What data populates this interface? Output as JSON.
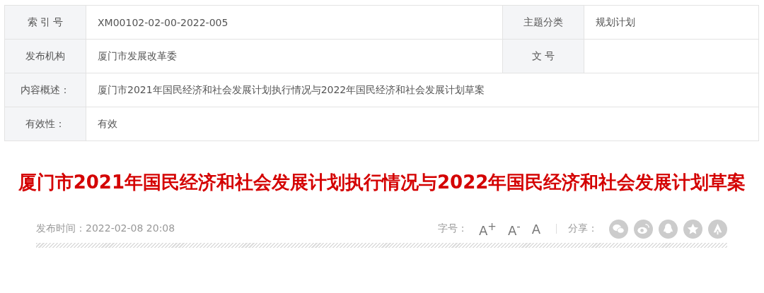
{
  "info_table": {
    "rows": [
      {
        "cells": [
          {
            "kind": "label",
            "text": "索 引 号"
          },
          {
            "kind": "value",
            "text": "XM00102-02-00-2022-005"
          },
          {
            "kind": "label",
            "text": "主题分类"
          },
          {
            "kind": "value",
            "text": "规划计划"
          }
        ]
      },
      {
        "cells": [
          {
            "kind": "label",
            "text": "发布机构"
          },
          {
            "kind": "value",
            "text": "厦门市发展改革委"
          },
          {
            "kind": "label",
            "text": "文 号"
          },
          {
            "kind": "value"
          }
        ]
      },
      {
        "cells": [
          {
            "kind": "label",
            "text": "内容概述："
          },
          {
            "kind": "wide",
            "text": "厦门市2021年国民经济和社会发展计划执行情况与2022年国民经济和社会发展计划草案"
          }
        ]
      },
      {
        "cells": [
          {
            "kind": "label",
            "text": "有效性："
          },
          {
            "kind": "wide",
            "text": "有效"
          }
        ]
      }
    ]
  },
  "article": {
    "title": "厦门市2021年国民经济和社会发展计划执行情况与2022年国民经济和社会发展计划草案",
    "publish_time": "发布时间：2022-02-08 20:08",
    "font_size": {
      "label": "字号：",
      "options": [
        "A$^{+}$",
        "A$^{-}$",
        "A"
      ]
    },
    "share": {
      "label": "分享：",
      "targets": [
        {
          "kind": "chat"
        },
        {
          "kind": "eye"
        },
        {
          "kind": "penguin"
        },
        {
          "kind": "star"
        },
        {
          "kind": "peace"
        }
      ]
    }
  }
}
